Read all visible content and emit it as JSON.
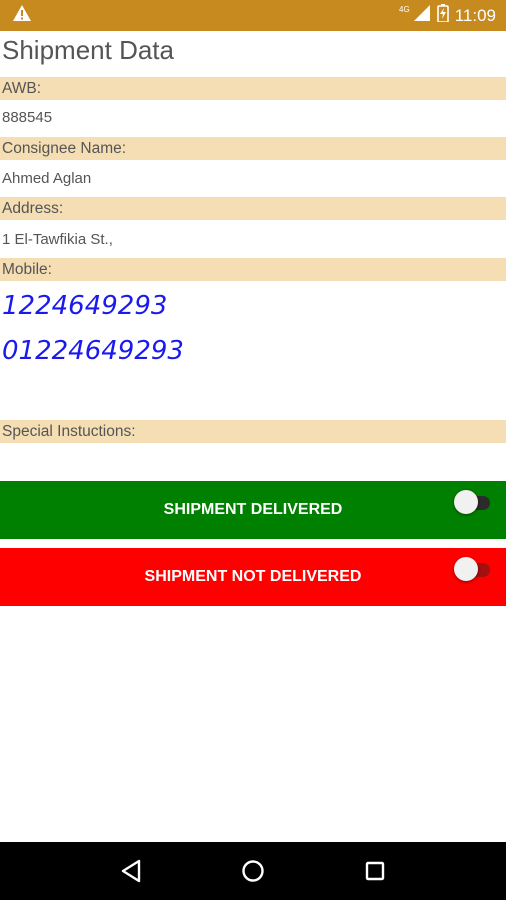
{
  "status_bar": {
    "time": "11:09",
    "network": "4G",
    "warning_icon": "warning-icon",
    "signal_icon": "signal-icon",
    "battery_icon": "battery-charging-icon"
  },
  "page": {
    "title": "Shipment Data"
  },
  "fields": {
    "awb_label": "AWB:",
    "awb_value": "888545",
    "consignee_label": "Consignee Name:",
    "consignee_value": "Ahmed Aglan",
    "address_label": "Address:",
    "address_value": "1 El-Tawfikia St.,",
    "mobile_label": "Mobile:",
    "mobile_values": [
      "1224649293",
      "01224649293"
    ],
    "special_label": "Special Instuctions:"
  },
  "actions": {
    "delivered_label": "SHIPMENT DELIVERED",
    "delivered_toggle_on": false,
    "not_delivered_label": "SHIPMENT NOT DELIVERED",
    "not_delivered_toggle_on": false
  },
  "nav": {
    "back_icon": "back-icon",
    "home_icon": "home-icon",
    "recents_icon": "recents-icon"
  },
  "colors": {
    "status_bar": "#c68a1e",
    "label_bg": "#f5deb3",
    "delivered_bg": "#008000",
    "not_delivered_bg": "#ff0000",
    "mobile_text": "#1a1aee"
  }
}
